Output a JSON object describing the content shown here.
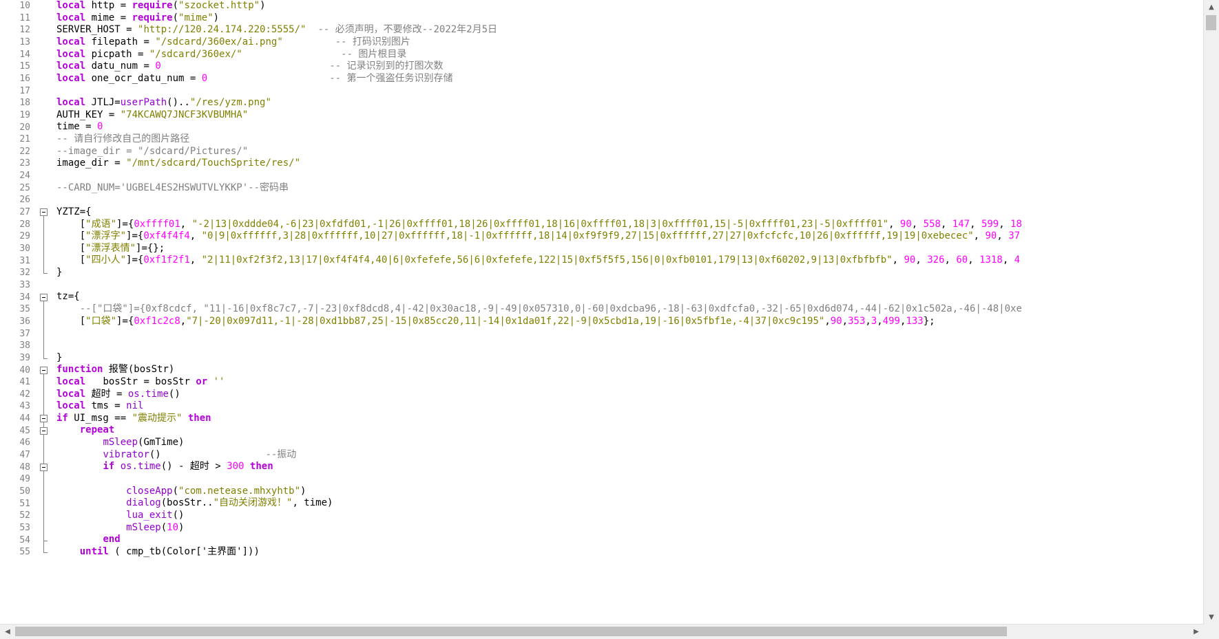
{
  "lines": [
    {
      "n": "10",
      "segs": [
        [
          "kw",
          "local"
        ],
        [
          "blk",
          " http = "
        ],
        [
          "kw",
          "require"
        ],
        [
          "blk",
          "("
        ],
        [
          "str",
          "\"szocket.http\""
        ],
        [
          "blk",
          ")"
        ]
      ]
    },
    {
      "n": "11",
      "segs": [
        [
          "kw",
          "local"
        ],
        [
          "blk",
          " mime = "
        ],
        [
          "kw",
          "require"
        ],
        [
          "blk",
          "("
        ],
        [
          "str",
          "\"mime\""
        ],
        [
          "blk",
          ")"
        ]
      ]
    },
    {
      "n": "12",
      "segs": [
        [
          "blk",
          "SERVER_HOST = "
        ],
        [
          "str",
          "\"http://120.24.174.220:5555/\""
        ],
        [
          "blk",
          "  "
        ],
        [
          "cmt",
          "-- 必须声明，不要修改--2022年2月5日"
        ]
      ]
    },
    {
      "n": "13",
      "segs": [
        [
          "kw",
          "local"
        ],
        [
          "blk",
          " filepath = "
        ],
        [
          "str",
          "\"/sdcard/360ex/ai.png\""
        ],
        [
          "blk",
          "         "
        ],
        [
          "cmt",
          "-- 打码识别图片"
        ]
      ]
    },
    {
      "n": "14",
      "segs": [
        [
          "kw",
          "local"
        ],
        [
          "blk",
          " picpath = "
        ],
        [
          "str",
          "\"/sdcard/360ex/\""
        ],
        [
          "blk",
          "                 "
        ],
        [
          "cmt",
          "-- 图片根目录"
        ]
      ]
    },
    {
      "n": "15",
      "segs": [
        [
          "kw",
          "local"
        ],
        [
          "blk",
          " datu_num = "
        ],
        [
          "num",
          "0"
        ],
        [
          "blk",
          "                             "
        ],
        [
          "cmt",
          "-- 记录识别到的打图次数"
        ]
      ]
    },
    {
      "n": "16",
      "segs": [
        [
          "kw",
          "local"
        ],
        [
          "blk",
          " one_ocr_datu_num = "
        ],
        [
          "num",
          "0"
        ],
        [
          "blk",
          "                     "
        ],
        [
          "cmt",
          "-- 第一个强盗任务识别存储"
        ]
      ]
    },
    {
      "n": "17",
      "segs": []
    },
    {
      "n": "18",
      "segs": [
        [
          "kw",
          "local"
        ],
        [
          "blk",
          " JTLJ="
        ],
        [
          "fn",
          "userPath"
        ],
        [
          "blk",
          "().."
        ],
        [
          "str",
          "\"/res/yzm.png\""
        ]
      ]
    },
    {
      "n": "19",
      "segs": [
        [
          "blk",
          "AUTH_KEY = "
        ],
        [
          "str",
          "\"74KCAWQ7JNCF3KVBUMHA\""
        ]
      ]
    },
    {
      "n": "20",
      "segs": [
        [
          "blk",
          "time = "
        ],
        [
          "num",
          "0"
        ]
      ]
    },
    {
      "n": "21",
      "segs": [
        [
          "cmt",
          "-- 请自行修改自己的图片路径"
        ]
      ]
    },
    {
      "n": "22",
      "segs": [
        [
          "cmt",
          "--image_dir = \"/sdcard/Pictures/\""
        ]
      ]
    },
    {
      "n": "23",
      "segs": [
        [
          "blk",
          "image_dir = "
        ],
        [
          "str",
          "\"/mnt/sdcard/TouchSprite/res/\""
        ]
      ]
    },
    {
      "n": "24",
      "segs": []
    },
    {
      "n": "25",
      "segs": [
        [
          "cmt",
          "--CARD_NUM='UGBEL4ES2HSWUTVLYKKP'--密码串"
        ]
      ]
    },
    {
      "n": "26",
      "segs": []
    },
    {
      "n": "27",
      "segs": [
        [
          "blk",
          "YZTZ={"
        ]
      ]
    },
    {
      "n": "28",
      "segs": [
        [
          "blk",
          "    ["
        ],
        [
          "str",
          "\"成语\""
        ],
        [
          "blk",
          "]={"
        ],
        [
          "num",
          "0xffff01"
        ],
        [
          "blk",
          ", "
        ],
        [
          "str",
          "\"-2|13|0xddde04,-6|23|0xfdfd01,-1|26|0xffff01,18|26|0xffff01,18|16|0xffff01,18|3|0xffff01,15|-5|0xffff01,23|-5|0xffff01\""
        ],
        [
          "blk",
          ", "
        ],
        [
          "num",
          "90"
        ],
        [
          "blk",
          ", "
        ],
        [
          "num",
          "558"
        ],
        [
          "blk",
          ", "
        ],
        [
          "num",
          "147"
        ],
        [
          "blk",
          ", "
        ],
        [
          "num",
          "599"
        ],
        [
          "blk",
          ", "
        ],
        [
          "num",
          "18"
        ]
      ]
    },
    {
      "n": "29",
      "segs": [
        [
          "blk",
          "    ["
        ],
        [
          "str",
          "\"漂浮字\""
        ],
        [
          "blk",
          "]={"
        ],
        [
          "num",
          "0xf4f4f4"
        ],
        [
          "blk",
          ", "
        ],
        [
          "str",
          "\"0|9|0xffffff,3|28|0xffffff,10|27|0xffffff,18|-1|0xffffff,18|14|0xf9f9f9,27|15|0xffffff,27|27|0xfcfcfc,10|26|0xffffff,19|19|0xebecec\""
        ],
        [
          "blk",
          ", "
        ],
        [
          "num",
          "90"
        ],
        [
          "blk",
          ", "
        ],
        [
          "num",
          "37"
        ]
      ]
    },
    {
      "n": "30",
      "segs": [
        [
          "blk",
          "    ["
        ],
        [
          "str",
          "\"漂浮表情\""
        ],
        [
          "blk",
          "]={};"
        ]
      ]
    },
    {
      "n": "31",
      "segs": [
        [
          "blk",
          "    ["
        ],
        [
          "str",
          "\"四小人\""
        ],
        [
          "blk",
          "]={"
        ],
        [
          "num",
          "0xf1f2f1"
        ],
        [
          "blk",
          ", "
        ],
        [
          "str",
          "\"2|11|0xf2f3f2,13|17|0xf4f4f4,40|6|0xfefefe,56|6|0xfefefe,122|15|0xf5f5f5,156|0|0xfb0101,179|13|0xf60202,9|13|0xfbfbfb\""
        ],
        [
          "blk",
          ", "
        ],
        [
          "num",
          "90"
        ],
        [
          "blk",
          ", "
        ],
        [
          "num",
          "326"
        ],
        [
          "blk",
          ", "
        ],
        [
          "num",
          "60"
        ],
        [
          "blk",
          ", "
        ],
        [
          "num",
          "1318"
        ],
        [
          "blk",
          ", "
        ],
        [
          "num",
          "4"
        ]
      ]
    },
    {
      "n": "32",
      "segs": [
        [
          "blk",
          "}"
        ]
      ]
    },
    {
      "n": "33",
      "segs": []
    },
    {
      "n": "34",
      "segs": [
        [
          "blk",
          "tz={"
        ]
      ]
    },
    {
      "n": "35",
      "segs": [
        [
          "blk",
          "    "
        ],
        [
          "cmt",
          "--[\"口袋\"]={0xf8cdcf, \"11|-16|0xf8c7c7,-7|-23|0xf8dcd8,4|-42|0x30ac18,-9|-49|0x057310,0|-60|0xdcba96,-18|-63|0xdfcfa0,-32|-65|0xd6d074,-44|-62|0x1c502a,-46|-48|0xe"
        ]
      ]
    },
    {
      "n": "36",
      "segs": [
        [
          "blk",
          "    ["
        ],
        [
          "str",
          "\"口袋\""
        ],
        [
          "blk",
          "]={"
        ],
        [
          "num",
          "0xf1c2c8"
        ],
        [
          "blk",
          ","
        ],
        [
          "str",
          "\"7|-20|0x097d11,-1|-28|0xd1bb87,25|-15|0x85cc20,11|-14|0x1da01f,22|-9|0x5cbd1a,19|-16|0x5fbf1e,-4|37|0xc9c195\""
        ],
        [
          "blk",
          ","
        ],
        [
          "num",
          "90"
        ],
        [
          "blk",
          ","
        ],
        [
          "num",
          "353"
        ],
        [
          "blk",
          ","
        ],
        [
          "num",
          "3"
        ],
        [
          "blk",
          ","
        ],
        [
          "num",
          "499"
        ],
        [
          "blk",
          ","
        ],
        [
          "num",
          "133"
        ],
        [
          "blk",
          "};"
        ]
      ]
    },
    {
      "n": "37",
      "segs": []
    },
    {
      "n": "38",
      "segs": []
    },
    {
      "n": "39",
      "segs": [
        [
          "blk",
          "}"
        ]
      ]
    },
    {
      "n": "40",
      "segs": [
        [
          "kw",
          "function"
        ],
        [
          "blk",
          " 报警(bosStr)"
        ]
      ]
    },
    {
      "n": "41",
      "segs": [
        [
          "kw",
          "local"
        ],
        [
          "blk",
          "   bosStr = bosStr "
        ],
        [
          "kw",
          "or"
        ],
        [
          "blk",
          " "
        ],
        [
          "str",
          "''"
        ]
      ]
    },
    {
      "n": "42",
      "segs": [
        [
          "kw",
          "local"
        ],
        [
          "blk",
          " 超时 = "
        ],
        [
          "fn",
          "os.time"
        ],
        [
          "blk",
          "()"
        ]
      ]
    },
    {
      "n": "43",
      "segs": [
        [
          "kw",
          "local"
        ],
        [
          "blk",
          " tms = "
        ],
        [
          "fn",
          "nil"
        ]
      ]
    },
    {
      "n": "44",
      "segs": [
        [
          "kw",
          "if"
        ],
        [
          "blk",
          " UI_msg == "
        ],
        [
          "str",
          "\"震动提示\""
        ],
        [
          "blk",
          " "
        ],
        [
          "kw",
          "then"
        ]
      ]
    },
    {
      "n": "45",
      "segs": [
        [
          "blk",
          "    "
        ],
        [
          "kw",
          "repeat"
        ]
      ]
    },
    {
      "n": "46",
      "segs": [
        [
          "blk",
          "        "
        ],
        [
          "fn",
          "mSleep"
        ],
        [
          "blk",
          "(GmTime)"
        ]
      ]
    },
    {
      "n": "47",
      "segs": [
        [
          "blk",
          "        "
        ],
        [
          "fn",
          "vibrator"
        ],
        [
          "blk",
          "()                  "
        ],
        [
          "cmt",
          "--振动"
        ]
      ]
    },
    {
      "n": "48",
      "segs": [
        [
          "blk",
          "        "
        ],
        [
          "kw",
          "if"
        ],
        [
          "blk",
          " "
        ],
        [
          "fn",
          "os.time"
        ],
        [
          "blk",
          "() - 超时 > "
        ],
        [
          "num",
          "300"
        ],
        [
          "blk",
          " "
        ],
        [
          "kw",
          "then"
        ]
      ]
    },
    {
      "n": "49",
      "segs": []
    },
    {
      "n": "50",
      "segs": [
        [
          "blk",
          "            "
        ],
        [
          "fn",
          "closeApp"
        ],
        [
          "blk",
          "("
        ],
        [
          "str",
          "\"com.netease.mhxyhtb\""
        ],
        [
          "blk",
          ")"
        ]
      ]
    },
    {
      "n": "51",
      "segs": [
        [
          "blk",
          "            "
        ],
        [
          "fn",
          "dialog"
        ],
        [
          "blk",
          "(bosStr.."
        ],
        [
          "str",
          "\"自动关闭游戏！\""
        ],
        [
          "blk",
          ", time)"
        ]
      ]
    },
    {
      "n": "52",
      "segs": [
        [
          "blk",
          "            "
        ],
        [
          "fn",
          "lua_exit"
        ],
        [
          "blk",
          "()"
        ]
      ]
    },
    {
      "n": "53",
      "segs": [
        [
          "blk",
          "            "
        ],
        [
          "fn",
          "mSleep"
        ],
        [
          "blk",
          "("
        ],
        [
          "num",
          "10"
        ],
        [
          "blk",
          ")"
        ]
      ]
    },
    {
      "n": "54",
      "segs": [
        [
          "blk",
          "        "
        ],
        [
          "kw",
          "end"
        ]
      ]
    },
    {
      "n": "55",
      "segs": [
        [
          "blk",
          "    "
        ],
        [
          "kw",
          "until"
        ],
        [
          "blk",
          " ( cmp_tb(Color['主界面']))"
        ]
      ]
    }
  ],
  "colors": {
    "keyword": "#b400d8",
    "string": "#808000",
    "comment": "#808080",
    "number": "#ff00ff",
    "function": "#9400d3"
  },
  "icons": {
    "scroll_up": "triangle-up-icon",
    "scroll_down": "triangle-down-icon",
    "scroll_left": "triangle-left-icon",
    "scroll_right": "triangle-right-icon",
    "fold": "minus-box-icon"
  }
}
